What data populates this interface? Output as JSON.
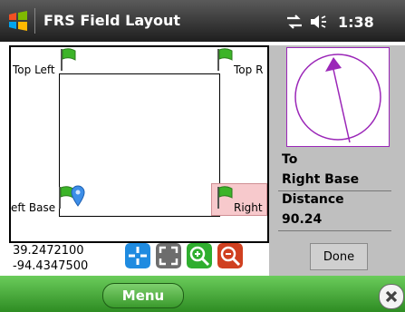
{
  "app": {
    "title": "FRS Field Layout"
  },
  "status": {
    "time": "1:38",
    "icons": [
      "connectivity-icon",
      "volume-icon"
    ]
  },
  "field": {
    "corners": {
      "top_left": "Top Left",
      "top_right": "Top R",
      "left_base": "eft Base",
      "right_base": "Right"
    }
  },
  "location": {
    "latitude": "39.2472100",
    "longitude": "-94.4347500"
  },
  "toolbar": {
    "icons": [
      "pan-icon",
      "fit-extent-icon",
      "zoom-in-icon",
      "zoom-out-icon"
    ]
  },
  "navigation": {
    "to_label": "To",
    "target": "Right Base",
    "distance_label": "Distance",
    "distance_value": "90.24",
    "done_label": "Done"
  },
  "softkeys": {
    "menu_label": "Menu"
  },
  "colors": {
    "titlebar": "#1e1e1e",
    "softbar": "#3aa02c",
    "compass": "#9b27b8",
    "highlight": "#f7c9cc",
    "pan_button": "#1f8be0",
    "zoom_in": "#2fae2f",
    "zoom_out": "#d04020"
  }
}
